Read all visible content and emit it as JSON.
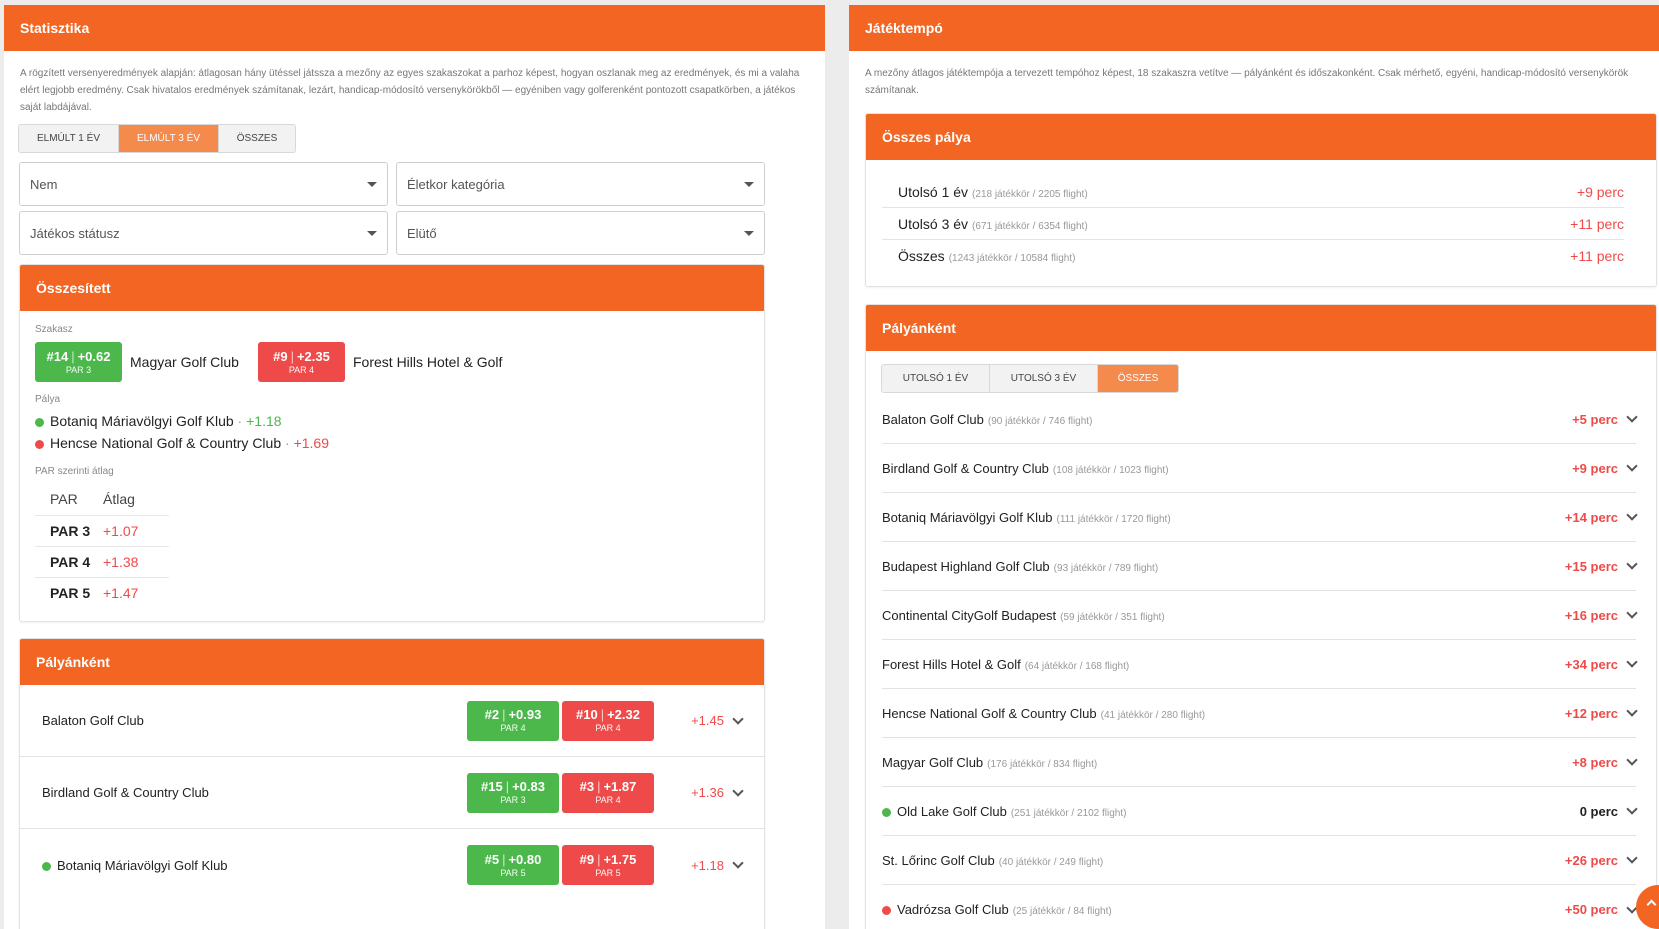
{
  "left": {
    "title": "Statisztika",
    "description": "A rögzített versenyeredmények alapján: átlagosan hány ütéssel játssza a mezőny az egyes szakaszokat a parhoz képest, hogyan oszlanak meg az eredmények, és mi a valaha elért legjobb eredmény. Csak hivatalos eredmények számítanak, lezárt, handicap-módosító versenykörökből — egyéniben vagy golferenként pontozott csapatkörben, a játékos saját labdájával.",
    "tabs": [
      {
        "label": "ELMÚLT 1 ÉV"
      },
      {
        "label": "ELMÚLT 3 ÉV"
      },
      {
        "label": "ÖSSZES"
      }
    ],
    "filters": {
      "gender": "Nem",
      "age": "Életkor kategória",
      "status": "Játékos státusz",
      "tee": "Elütő"
    },
    "summary": {
      "title": "Összesített",
      "hole_label": "Szakasz",
      "best_hole": {
        "hole": "#14",
        "value": "+0.62",
        "par": "PAR 3",
        "course": "Magyar Golf Club"
      },
      "worst_hole": {
        "hole": "#9",
        "value": "+2.35",
        "par": "PAR 4",
        "course": "Forest Hills Hotel & Golf"
      },
      "course_label": "Pálya",
      "best_course": {
        "name": "Botaniq Máriavölgyi Golf Klub",
        "value": "+1.18"
      },
      "worst_course": {
        "name": "Hencse National Golf & Country Club",
        "value": "+1.69"
      },
      "par_label": "PAR szerinti átlag",
      "par_header": {
        "par": "PAR",
        "avg": "Átlag"
      },
      "par_rows": [
        {
          "par": "PAR 3",
          "avg": "+1.07"
        },
        {
          "par": "PAR 4",
          "avg": "+1.38"
        },
        {
          "par": "PAR 5",
          "avg": "+1.47"
        }
      ]
    },
    "courses": {
      "title": "Pályánként",
      "rows": [
        {
          "name": "Balaton Golf Club",
          "best": {
            "hole": "#2",
            "value": "+0.93",
            "par": "PAR 4"
          },
          "worst": {
            "hole": "#10",
            "value": "+2.32",
            "par": "PAR 4"
          },
          "avg": "+1.45"
        },
        {
          "name": "Birdland Golf & Country Club",
          "best": {
            "hole": "#15",
            "value": "+0.83",
            "par": "PAR 3"
          },
          "worst": {
            "hole": "#3",
            "value": "+1.87",
            "par": "PAR 4"
          },
          "avg": "+1.36"
        },
        {
          "name": "Botaniq Máriavölgyi Golf Klub",
          "best": {
            "hole": "#5",
            "value": "+0.80",
            "par": "PAR 5"
          },
          "worst": {
            "hole": "#9",
            "value": "+1.75",
            "par": "PAR 5"
          },
          "avg": "+1.18"
        }
      ]
    }
  },
  "right": {
    "title": "Játéktempó",
    "description": "A mezőny átlagos játéktempója a tervezett tempóhoz képest, 18 szakaszra vetítve — pályánként és időszakonként. Csak mérhető, egyéni, handicap-módosító versenykörök számítanak.",
    "overall": {
      "title": "Összes pálya",
      "rows": [
        {
          "label": "Utolsó 1 év",
          "meta": "(218 játékkör / 2205 flight)",
          "value": "+9 perc"
        },
        {
          "label": "Utolsó 3 év",
          "meta": "(671 játékkör / 6354 flight)",
          "value": "+11 perc"
        },
        {
          "label": "Összes",
          "meta": "(1243 játékkör / 10584 flight)",
          "value": "+11 perc"
        }
      ]
    },
    "per_course": {
      "title": "Pályánként",
      "tabs": [
        {
          "label": "UTOLSÓ 1 ÉV"
        },
        {
          "label": "UTOLSÓ 3 ÉV"
        },
        {
          "label": "ÖSSZES"
        }
      ],
      "rows": [
        {
          "name": "Balaton Golf Club",
          "meta": "(90 játékkör / 746 flight)",
          "value": "+5 perc"
        },
        {
          "name": "Birdland Golf & Country Club",
          "meta": "(108 játékkör / 1023 flight)",
          "value": "+9 perc"
        },
        {
          "name": "Botaniq Máriavölgyi Golf Klub",
          "meta": "(111 játékkör / 1720 flight)",
          "value": "+14 perc"
        },
        {
          "name": "Budapest Highland Golf Club",
          "meta": "(93 játékkör / 789 flight)",
          "value": "+15 perc"
        },
        {
          "name": "Continental CityGolf Budapest",
          "meta": "(59 játékkör / 351 flight)",
          "value": "+16 perc"
        },
        {
          "name": "Forest Hills Hotel & Golf",
          "meta": "(64 játékkör / 168 flight)",
          "value": "+34 perc"
        },
        {
          "name": "Hencse National Golf & Country Club",
          "meta": "(41 játékkör / 280 flight)",
          "value": "+12 perc"
        },
        {
          "name": "Magyar Golf Club",
          "meta": "(176 játékkör / 834 flight)",
          "value": "+8 perc"
        },
        {
          "name": "Old Lake Golf Club",
          "meta": "(251 játékkör / 2102 flight)",
          "value": "0 perc"
        },
        {
          "name": "St. Lőrinc Golf Club",
          "meta": "(40 játékkör / 249 flight)",
          "value": "+26 perc"
        },
        {
          "name": "Vadrózsa Golf Club",
          "meta": "(25 játékkör / 84 flight)",
          "value": "+50 perc"
        }
      ]
    }
  },
  "colors": {
    "accent": "#f26522",
    "good": "#4cb84c",
    "bad": "#ef4a4a"
  }
}
